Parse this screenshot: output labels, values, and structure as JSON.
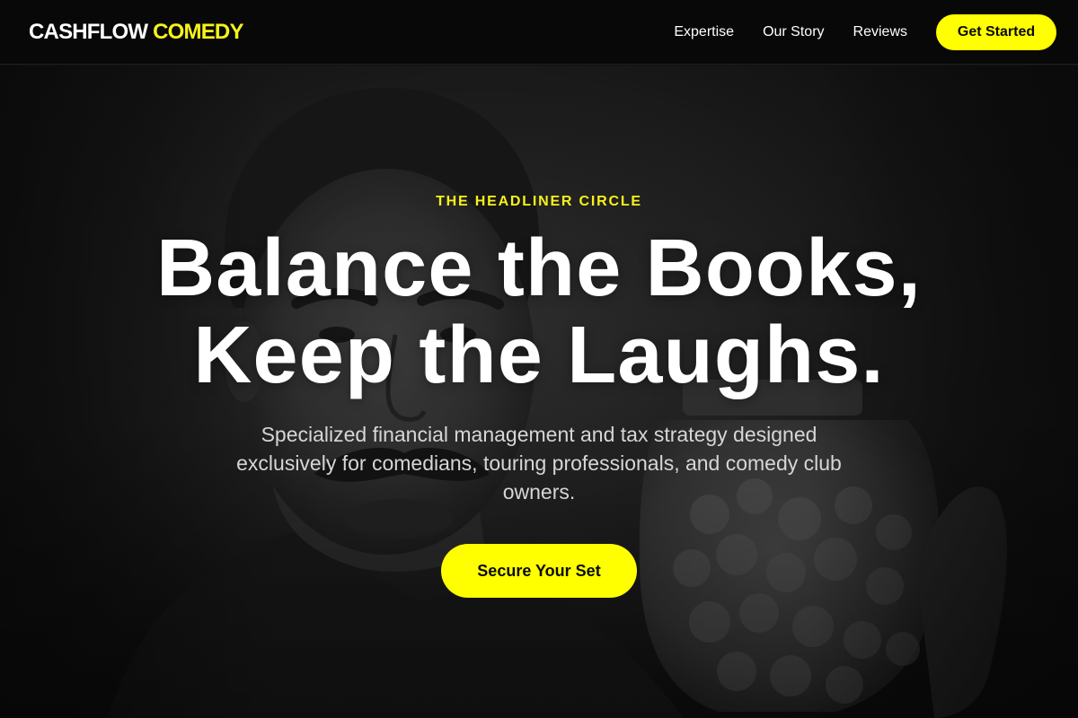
{
  "nav": {
    "logo_main": "CASHFLOW",
    "logo_accent": "COMEDY",
    "links": [
      "Expertise",
      "Our Story",
      "Reviews"
    ],
    "cta_label": "Get Started"
  },
  "hero": {
    "eyebrow": "THE HEADLINER CIRCLE",
    "headline_line1": "Balance the Books,",
    "headline_line2": "Keep the Laughs.",
    "subtitle": "Specialized financial management and tax strategy designed exclusively for comedians, touring professionals, and comedy club owners.",
    "cta_label": "Secure Your Set"
  },
  "colors": {
    "accent": "#ffff00",
    "nav_background": "#080808",
    "hero_text": "#ffffff",
    "subtitle_text": "#d6d6d6"
  }
}
